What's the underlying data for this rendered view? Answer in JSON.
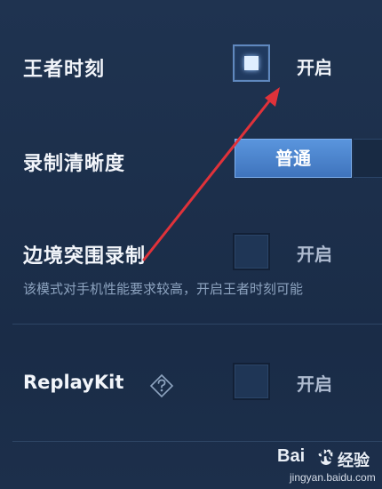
{
  "settings": {
    "king_moment": {
      "label": "王者时刻",
      "checked": true,
      "toggle_label": "开启"
    },
    "recording_quality": {
      "label": "录制清晰度",
      "selected_option": "普通"
    },
    "border_breakout": {
      "label": "边境突围录制",
      "checked": false,
      "toggle_label": "开启",
      "description": "该模式对手机性能要求较高，开启王者时刻可能"
    },
    "replaykit": {
      "label": "ReplayKit",
      "checked": false,
      "toggle_label": "开启",
      "help_icon": "question-diamond-icon"
    }
  },
  "annotation": {
    "arrow_color": "#e0323a"
  },
  "watermark": {
    "brand": "Bai",
    "brand_suffix": "du",
    "cn": "经验",
    "url": "jingyan.baidu.com"
  },
  "colors": {
    "accent": "#4a84cf",
    "background": "#1c2f4b",
    "text": "#f2f5fa"
  }
}
